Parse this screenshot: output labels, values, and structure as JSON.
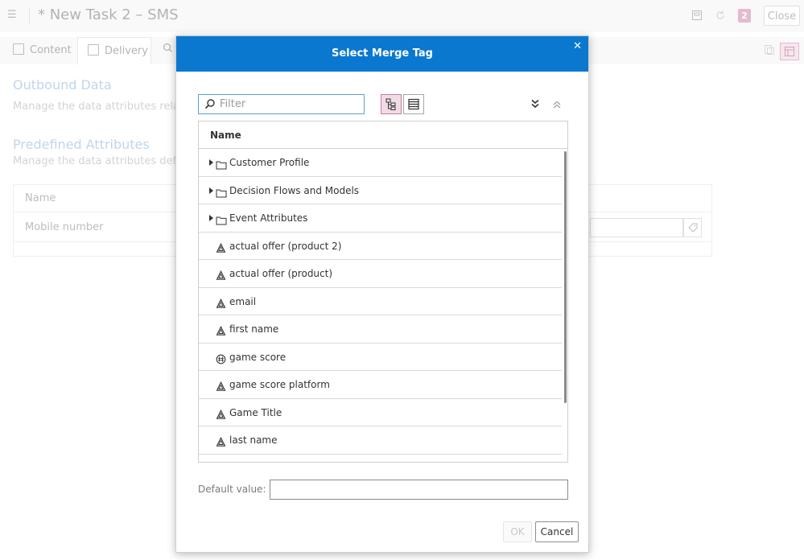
{
  "app": {
    "title": "* New Task 2 – SMS",
    "badge_count": "2",
    "close_label": "Close",
    "menu_icon": "list-menu-icon"
  },
  "tabs": [
    {
      "label": "Content",
      "icon": "document-icon"
    },
    {
      "label": "Delivery",
      "icon": "document-icon",
      "active": true
    },
    {
      "label": "",
      "icon": "search-gear-icon"
    }
  ],
  "page": {
    "outbound_title": "Outbound Data",
    "outbound_desc": "Manage the data attributes related to",
    "predefined_title": "Predefined Attributes",
    "predefined_desc": "Manage the data attributes defi",
    "table_header_name": "Name",
    "row_mobile": "Mobile number"
  },
  "dialog": {
    "title": "Select Merge Tag",
    "filter_placeholder": "Filter",
    "filter_value": "",
    "column_name": "Name",
    "items": [
      {
        "label": "Customer Profile",
        "type": "folder",
        "expandable": true
      },
      {
        "label": "Decision Flows and Models",
        "type": "folder",
        "expandable": true
      },
      {
        "label": "Event Attributes",
        "type": "folder",
        "expandable": true
      },
      {
        "label": "actual offer (product 2)",
        "type": "attribute"
      },
      {
        "label": "actual offer (product)",
        "type": "attribute"
      },
      {
        "label": "email",
        "type": "attribute"
      },
      {
        "label": "first name",
        "type": "attribute"
      },
      {
        "label": "game score",
        "type": "numeric"
      },
      {
        "label": "game score platform",
        "type": "attribute"
      },
      {
        "label": "Game Title",
        "type": "attribute"
      },
      {
        "label": "last name",
        "type": "attribute"
      }
    ],
    "default_value_label": "Default value:",
    "default_value": "",
    "ok_label": "OK",
    "cancel_label": "Cancel"
  },
  "colors": {
    "dialog_header": "#0b78d0",
    "accent_pink": "#d895b7",
    "section_title": "#9ec1e0"
  }
}
